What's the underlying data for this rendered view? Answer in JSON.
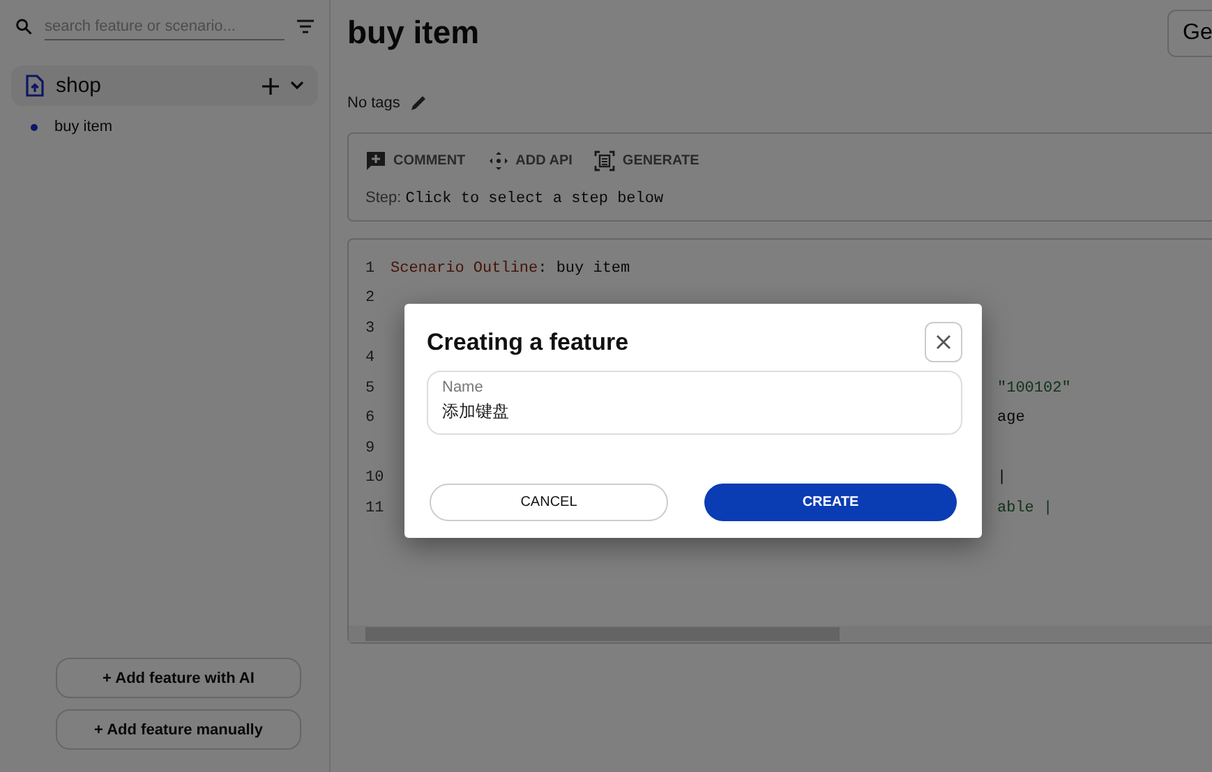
{
  "sidebar": {
    "search": {
      "placeholder": "search feature or scenario..."
    },
    "features": [
      {
        "name": "shop",
        "expanded": true,
        "scenarios": [
          {
            "name": "buy item",
            "selected": true
          }
        ]
      }
    ],
    "buttons": [
      "+ Add feature with AI",
      "+ Add feature manually"
    ]
  },
  "main": {
    "title": "buy item",
    "header_button": "Ge",
    "tags": "No tags",
    "toolbar": [
      {
        "kind": "comment",
        "label": "COMMENT"
      },
      {
        "kind": "api",
        "label": "ADD API"
      },
      {
        "kind": "generate",
        "label": "GENERATE"
      }
    ],
    "step": {
      "label": "Step:",
      "value": "Click to select a step below"
    },
    "code_lines": [
      {
        "number": "1",
        "keyword": "Scenario Outline",
        "text": ": buy item"
      },
      {
        "number": "2"
      },
      {
        "number": "3"
      },
      {
        "number": "4"
      },
      {
        "number": "5",
        "tail": "\"100102\"",
        "kind": "string"
      },
      {
        "number": "6",
        "tail": "age",
        "kind": "plain"
      },
      {
        "number": "9"
      },
      {
        "number": "10",
        "tail": "|",
        "kind": "plain"
      },
      {
        "number": "11",
        "tail": "able |",
        "kind": "string"
      }
    ]
  },
  "dialog": {
    "title": "Creating a feature",
    "field": {
      "label": "Name",
      "value": "添加键盘"
    },
    "buttons": [
      {
        "kind": "secondary",
        "label": "CANCEL"
      },
      {
        "kind": "primary",
        "label": "CREATE"
      }
    ]
  }
}
